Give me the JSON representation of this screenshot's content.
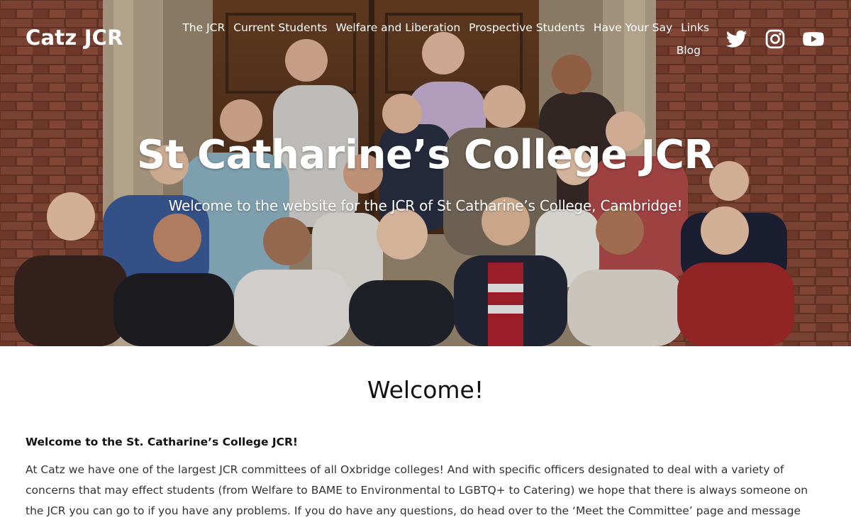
{
  "header": {
    "site_title": "Catz JCR",
    "nav": [
      {
        "label": "The JCR"
      },
      {
        "label": "Current Students"
      },
      {
        "label": "Welfare and Liberation"
      },
      {
        "label": "Prospective Students"
      },
      {
        "label": "Have Your Say"
      },
      {
        "label": "Links"
      },
      {
        "label": "Blog"
      }
    ],
    "socials": [
      {
        "icon": "twitter-icon"
      },
      {
        "icon": "instagram-icon"
      },
      {
        "icon": "youtube-icon"
      }
    ]
  },
  "hero": {
    "title": "St Catharine’s College JCR",
    "subtitle": "Welcome to the website for the JCR of St Catharine’s College, Cambridge!"
  },
  "main": {
    "heading": "Welcome!",
    "lead": "Welcome to the St. Catharine’s College JCR!",
    "paragraph": "At Catz we have one of the largest JCR committees of all Oxbridge colleges! And with specific officers designated to deal with a variety of concerns that may effect students (from Welfare to BAME to Environmental to LGBTQ+ to Catering) we hope that there is always someone on the JCR you can go to if you have any problems. If you do have any questions, do head over to the ‘Meet the Committee’ page and message"
  },
  "colors": {
    "text_dark": "#111111",
    "text_body": "#333333",
    "hero_text": "#ffffff"
  }
}
